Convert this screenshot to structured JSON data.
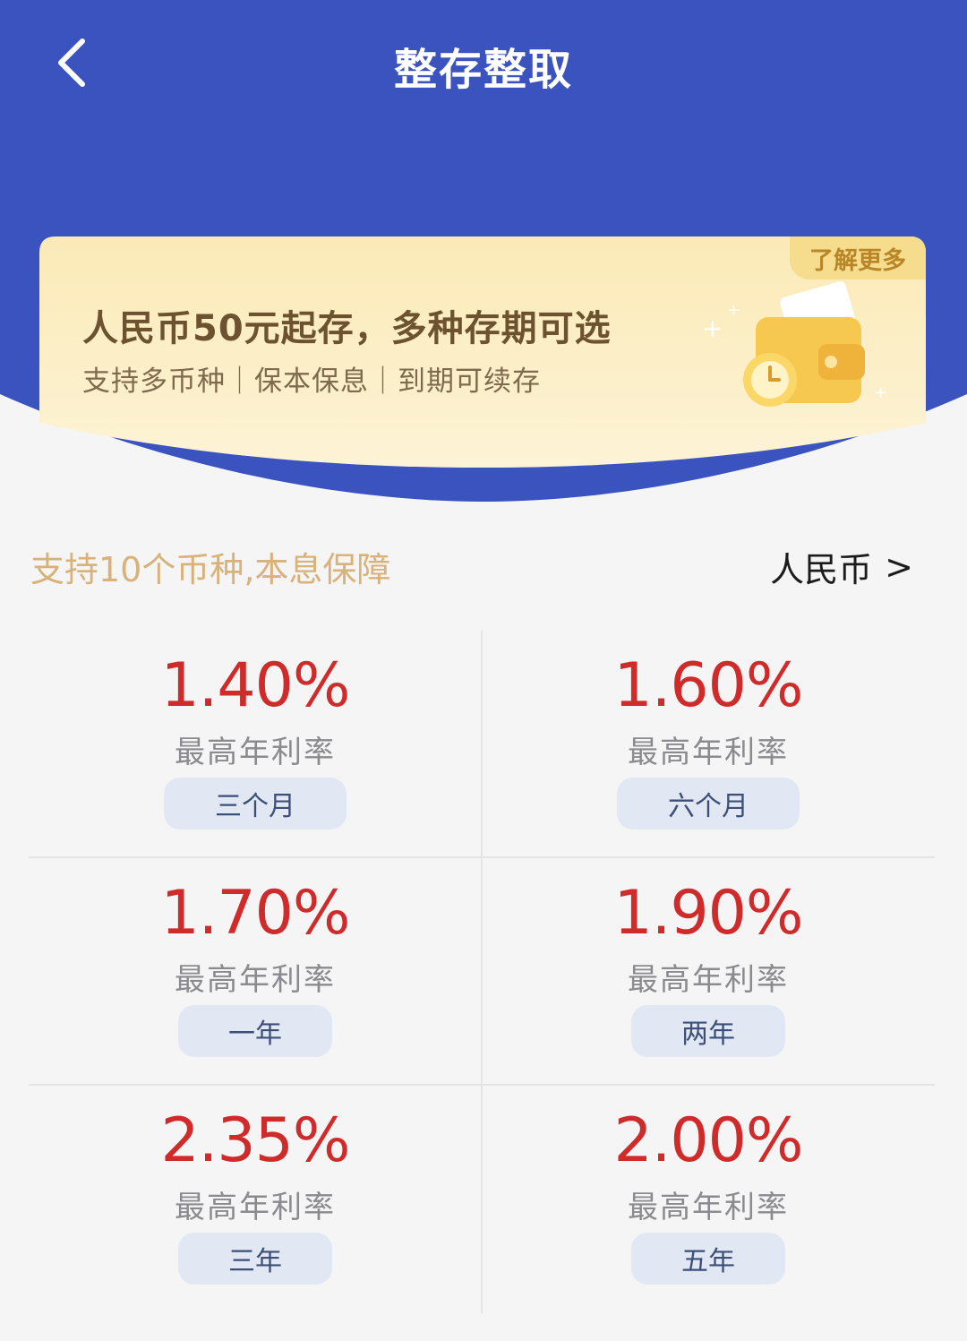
{
  "nav": {
    "title": "整存整取",
    "back_icon": "chevron-left-icon"
  },
  "colors": {
    "header_blue": "#3b53bf",
    "rate_red": "#d02b2b",
    "accent_gold": "#d8b27a",
    "pill_bg": "#e1e8f4"
  },
  "promo": {
    "learn_more": "了解更多",
    "headline": "人民币50元起存，多种存期可选",
    "subline": "支持多币种｜保本保息｜到期可续存",
    "illustration": "wallet-clock-icon"
  },
  "section": {
    "note": "支持10个币种,本息保障",
    "currency": "人民币",
    "currency_arrow": ">"
  },
  "rates": [
    {
      "rate": "1.40%",
      "label": "最高年利率",
      "term": "三个月"
    },
    {
      "rate": "1.60%",
      "label": "最高年利率",
      "term": "六个月"
    },
    {
      "rate": "1.70%",
      "label": "最高年利率",
      "term": "一年"
    },
    {
      "rate": "1.90%",
      "label": "最高年利率",
      "term": "两年"
    },
    {
      "rate": "2.35%",
      "label": "最高年利率",
      "term": "三年"
    },
    {
      "rate": "2.00%",
      "label": "最高年利率",
      "term": "五年"
    }
  ]
}
